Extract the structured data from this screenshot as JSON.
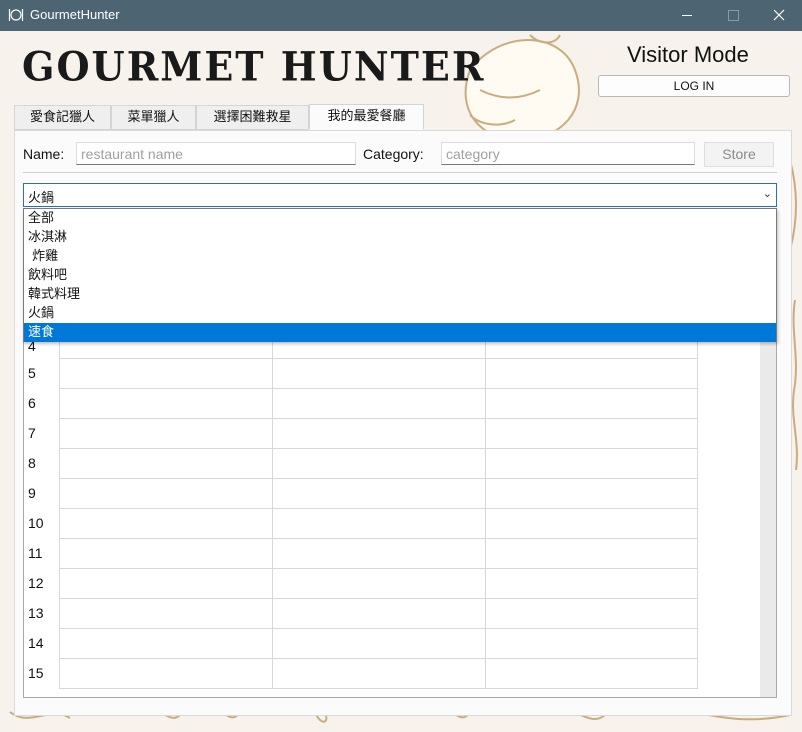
{
  "window": {
    "title": "GourmetHunter"
  },
  "header": {
    "logo": "GOURMET HUNTER",
    "mode": "Visitor Mode",
    "login_label": "LOG IN"
  },
  "tabs": [
    {
      "label": "愛食記獵人",
      "active": false
    },
    {
      "label": "菜單獵人",
      "active": false
    },
    {
      "label": "選擇困難救星",
      "active": false
    },
    {
      "label": "我的最愛餐廳",
      "active": true
    }
  ],
  "form": {
    "name_label": "Name:",
    "name_placeholder": "restaurant name",
    "category_label": "Category:",
    "category_placeholder": "category",
    "store_label": "Store"
  },
  "category_select": {
    "selected": "火鍋",
    "options": [
      "全部",
      "冰淇淋",
      " 炸雞",
      "飲料吧",
      "韓式料理",
      "火鍋",
      "速食"
    ],
    "highlighted_index": 6
  },
  "table": {
    "visible_row_numbers": [
      "4",
      "5",
      "6",
      "7",
      "8",
      "9",
      "10",
      "11",
      "12",
      "13",
      "14",
      "15"
    ]
  },
  "colors": {
    "titlebar": "#4d6472",
    "selection": "#0078d7",
    "background": "#f7f2ec"
  }
}
